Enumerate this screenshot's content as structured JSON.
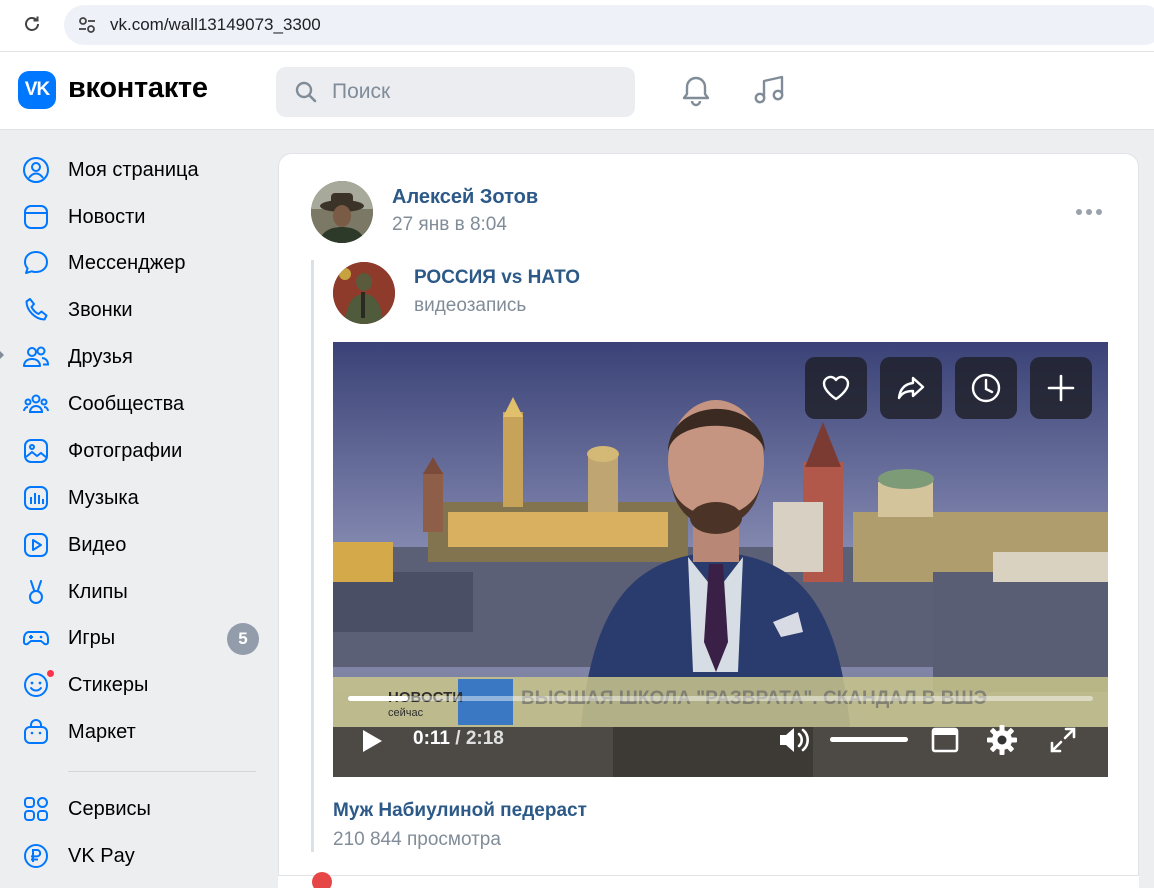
{
  "browser": {
    "url": "vk.com/wall13149073_3300"
  },
  "header": {
    "logo_mark": "VK",
    "wordmark": "вконтакте",
    "search_placeholder": "Поиск",
    "icons": [
      "bell-icon",
      "music-note-icon"
    ]
  },
  "sidebar": {
    "items": [
      {
        "label": "Моя страница",
        "icon": "user-circle-icon"
      },
      {
        "label": "Новости",
        "icon": "news-icon"
      },
      {
        "label": "Мессенджер",
        "icon": "chat-bubble-icon"
      },
      {
        "label": "Звонки",
        "icon": "phone-icon"
      },
      {
        "label": "Друзья",
        "icon": "friends-icon"
      },
      {
        "label": "Сообщества",
        "icon": "communities-icon"
      },
      {
        "label": "Фотографии",
        "icon": "photo-icon"
      },
      {
        "label": "Музыка",
        "icon": "music-icon"
      },
      {
        "label": "Видео",
        "icon": "video-icon"
      },
      {
        "label": "Клипы",
        "icon": "clips-icon"
      },
      {
        "label": "Игры",
        "icon": "gamepad-icon",
        "badge": "5"
      },
      {
        "label": "Стикеры",
        "icon": "smile-icon",
        "dot": true
      },
      {
        "label": "Маркет",
        "icon": "market-bag-icon"
      }
    ],
    "extra_items": [
      {
        "label": "Сервисы",
        "icon": "services-icon"
      },
      {
        "label": "VK Pay",
        "icon": "ruble-icon"
      }
    ],
    "accent": "#0077ff",
    "badge_color": "#939cab",
    "dot_color": "#ff3347"
  },
  "post": {
    "author": "Алексей Зотов",
    "time": "27 янв в 8:04",
    "repost": {
      "source": "РОССИЯ vs НАТО",
      "type": "видеозапись"
    },
    "video": {
      "ticker_brand": "НОВОСТИ",
      "ticker_sub": "сейчас",
      "ticker_text": "ВЫСШАЯ ШКОЛА \"РАЗВРАТА\". СКАНДАЛ В ВШЭ",
      "current_time": "0:11",
      "separator": "/",
      "total_time": "2:18",
      "progress": 0.08,
      "volume": 1.0,
      "action_buttons": [
        "heart-icon",
        "share-arrow-icon",
        "clock-icon",
        "plus-icon"
      ],
      "controls": [
        "play-icon",
        "volume-icon",
        "miniplayer-icon",
        "settings-gear-icon",
        "fullscreen-icon"
      ]
    },
    "video_title": "Муж Набиулиной педераст",
    "views": "210 844 просмотра",
    "link_color": "#2c5987",
    "meta_color": "#818c99"
  }
}
